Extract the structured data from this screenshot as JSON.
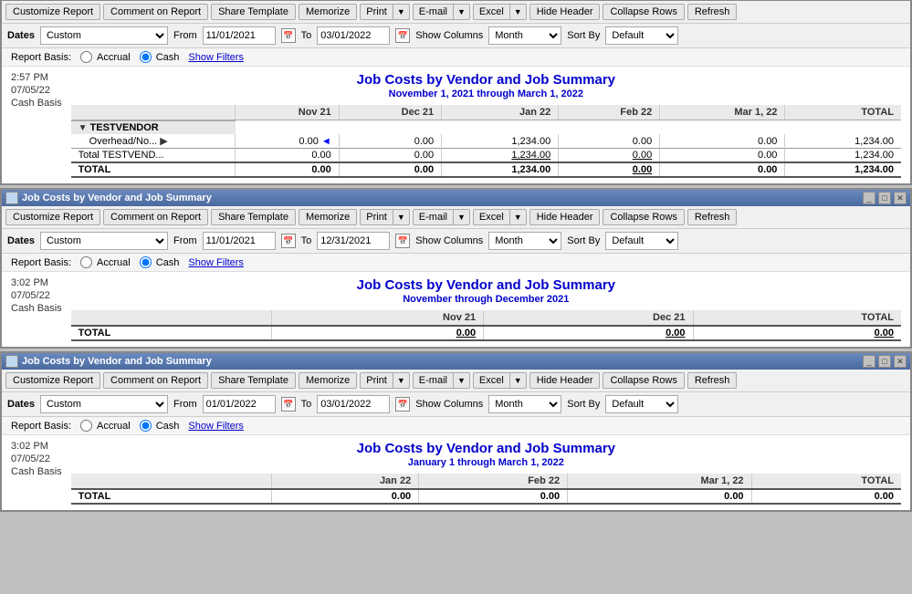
{
  "windows": [
    {
      "id": "window1",
      "title": "",
      "showTitlebar": false,
      "toolbar": {
        "buttons": [
          "Customize Report",
          "Comment on Report",
          "Share Template",
          "Memorize"
        ],
        "splitButtons": [
          "Print",
          "E-mail",
          "Excel"
        ],
        "rightButtons": [
          "Hide Header",
          "Collapse Rows",
          "Refresh"
        ]
      },
      "filters": {
        "datesLabel": "Dates",
        "datesValue": "Custom",
        "fromLabel": "From",
        "fromValue": "11/01/2021",
        "toLabel": "To",
        "toValue": "03/01/2022",
        "showColumnsLabel": "Show Columns",
        "showColumnsValue": "Month",
        "sortByLabel": "Sort By",
        "sortByValue": "Default"
      },
      "reportBasis": {
        "label": "Report Basis:",
        "accrualLabel": "Accrual",
        "cashLabel": "Cash",
        "cashChecked": true,
        "showFiltersLabel": "Show Filters"
      },
      "report": {
        "time": "2:57 PM",
        "date": "07/05/22",
        "basis": "Cash Basis",
        "title": "Job Costs by Vendor and Job Summary",
        "subtitle": "November 1, 2021 through March 1, 2022",
        "columns": [
          "",
          "Nov 21",
          "Dec 21",
          "Jan 22",
          "Feb 22",
          "Mar 1, 22",
          "TOTAL"
        ],
        "sections": [
          {
            "name": "TESTVENDOR",
            "rows": [
              {
                "label": "Overhead/No...",
                "hasArrow": true,
                "values": [
                  "0.00",
                  "0.00",
                  "1,234.00",
                  "0.00",
                  "0.00",
                  "1,234.00"
                ],
                "arrowPos": 1
              }
            ],
            "subtotals": {
              "label": "Total TESTVEND...",
              "values": [
                "0.00",
                "0.00",
                "1,234.00",
                "0.00",
                "0.00",
                "1,234.00"
              ]
            }
          }
        ],
        "grandTotal": {
          "label": "TOTAL",
          "values": [
            "0.00",
            "0.00",
            "1,234.00",
            "0.00",
            "0.00",
            "1,234.00"
          ]
        }
      }
    },
    {
      "id": "window2",
      "title": "Job Costs by Vendor and Job Summary",
      "showTitlebar": true,
      "toolbar": {
        "buttons": [
          "Customize Report",
          "Comment on Report",
          "Share Template",
          "Memorize"
        ],
        "splitButtons": [
          "Print",
          "E-mail",
          "Excel"
        ],
        "rightButtons": [
          "Hide Header",
          "Collapse Rows",
          "Refresh"
        ]
      },
      "filters": {
        "datesLabel": "Dates",
        "datesValue": "Custom",
        "fromLabel": "From",
        "fromValue": "11/01/2021",
        "toLabel": "To",
        "toValue": "12/31/2021",
        "showColumnsLabel": "Show Columns",
        "showColumnsValue": "Month",
        "sortByLabel": "Sort By",
        "sortByValue": "Default"
      },
      "reportBasis": {
        "label": "Report Basis:",
        "accrualLabel": "Accrual",
        "cashLabel": "Cash",
        "cashChecked": true,
        "showFiltersLabel": "Show Filters"
      },
      "report": {
        "time": "3:02 PM",
        "date": "07/05/22",
        "basis": "Cash Basis",
        "title": "Job Costs by Vendor and Job Summary",
        "subtitle": "November through December 2021",
        "columns": [
          "",
          "Nov 21",
          "Dec 21",
          "TOTAL"
        ],
        "sections": [],
        "grandTotal": {
          "label": "TOTAL",
          "values": [
            "0.00",
            "0.00",
            "0.00"
          ]
        }
      }
    },
    {
      "id": "window3",
      "title": "Job Costs by Vendor and Job Summary",
      "showTitlebar": true,
      "toolbar": {
        "buttons": [
          "Customize Report",
          "Comment on Report",
          "Share Template",
          "Memorize"
        ],
        "splitButtons": [
          "Print",
          "E-mail",
          "Excel"
        ],
        "rightButtons": [
          "Hide Header",
          "Collapse Rows",
          "Refresh"
        ]
      },
      "filters": {
        "datesLabel": "Dates",
        "datesValue": "Custom",
        "fromLabel": "From",
        "fromValue": "01/01/2022",
        "toLabel": "To",
        "toValue": "03/01/2022",
        "showColumnsLabel": "Show Columns",
        "showColumnsValue": "Month",
        "sortByLabel": "Sort By",
        "sortByValue": "Default"
      },
      "reportBasis": {
        "label": "Report Basis:",
        "accrualLabel": "Accrual",
        "cashLabel": "Cash",
        "cashChecked": true,
        "showFiltersLabel": "Show Filters"
      },
      "report": {
        "time": "3:02 PM",
        "date": "07/05/22",
        "basis": "Cash Basis",
        "title": "Job Costs by Vendor and Job Summary",
        "subtitle": "January 1 through March 1, 2022",
        "columns": [
          "",
          "Jan 22",
          "Feb 22",
          "Mar 1, 22",
          "TOTAL"
        ],
        "sections": [],
        "grandTotal": {
          "label": "TOTAL",
          "values": [
            "0.00",
            "0.00",
            "0.00",
            "0.00"
          ]
        }
      }
    }
  ]
}
